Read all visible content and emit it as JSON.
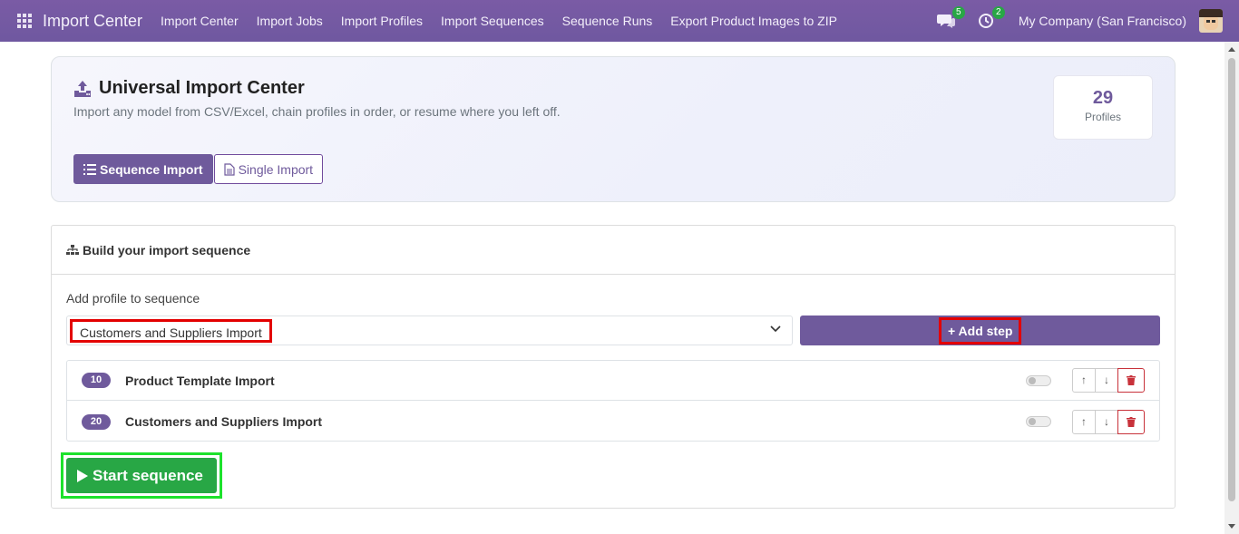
{
  "navbar": {
    "brand": "Import Center",
    "menu": [
      "Import Center",
      "Import Jobs",
      "Import Profiles",
      "Import Sequences",
      "Sequence Runs",
      "Export Product Images to ZIP"
    ],
    "messages_count": "5",
    "activities_count": "2",
    "company": "My Company (San Francisco)"
  },
  "header": {
    "title": "Universal Import Center",
    "subtitle": "Import any model from CSV/Excel, chain profiles in order, or resume where you left off.",
    "stat_value": "29",
    "stat_label": "Profiles",
    "tabs": [
      {
        "label": "Sequence Import",
        "active": true
      },
      {
        "label": "Single Import",
        "active": false
      }
    ]
  },
  "builder": {
    "title": "Build your import sequence",
    "add_label": "Add profile to sequence",
    "selected_profile": "Customers and Suppliers Import",
    "add_step_label": "+ Add step",
    "steps": [
      {
        "seq": "10",
        "name": "Product Template Import",
        "up": "↑",
        "down": "↓"
      },
      {
        "seq": "20",
        "name": "Customers and Suppliers Import",
        "up": "↑",
        "down": "↓"
      }
    ],
    "start_label": "Start sequence"
  },
  "colors": {
    "brand": "#6f5a9c",
    "success": "#28a745",
    "highlight_red": "#e30000",
    "highlight_green": "#1de22c"
  }
}
